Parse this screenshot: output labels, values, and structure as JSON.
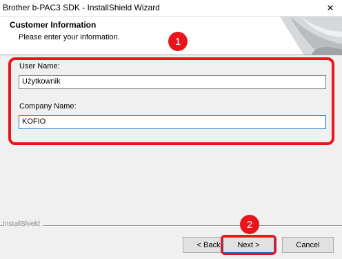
{
  "window": {
    "title": "Brother b-PAC3 SDK - InstallShield Wizard",
    "close_glyph": "✕"
  },
  "header": {
    "title": "Customer Information",
    "subtitle": "Please enter your information."
  },
  "form": {
    "user_name_label": "User Name:",
    "user_name_value": "Użytkownik",
    "company_name_label": "Company Name:",
    "company_name_value": "KOFIO"
  },
  "annotations": {
    "badge1": "1",
    "badge2": "2",
    "accent_color": "#e8151c"
  },
  "footer": {
    "brand": "InstallShield"
  },
  "buttons": {
    "back": "< Back",
    "next": "Next >",
    "cancel": "Cancel"
  }
}
